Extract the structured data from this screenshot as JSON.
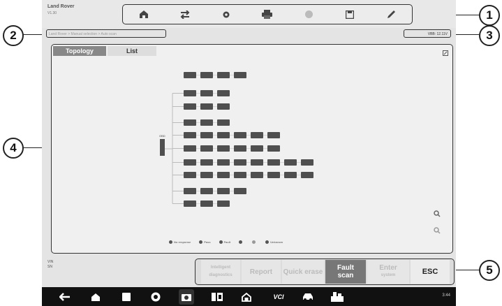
{
  "header": {
    "vehicle": "Land Rover",
    "sub": "V1.30"
  },
  "toolbar": {
    "items": [
      "home-icon",
      "swap-icon",
      "settings-icon",
      "print-icon",
      "help-icon",
      "save-icon",
      "edit-icon"
    ]
  },
  "breadcrumb": {
    "text": "Land Rover > Manual selection > Auto scan"
  },
  "voltage": {
    "text": "VBB: 12.11V"
  },
  "tabs": {
    "topology": "Topology",
    "list": "List"
  },
  "diagram": {
    "hub_label": "OBD",
    "rows": [
      {
        "labels": [
          "",
          "",
          "",
          ""
        ]
      },
      {
        "labels": [
          "",
          "",
          ""
        ]
      },
      {
        "labels": [
          "",
          "",
          ""
        ]
      },
      {
        "labels": [
          "",
          "",
          ""
        ]
      },
      {
        "labels": [
          "",
          "",
          "",
          "",
          "",
          ""
        ]
      },
      {
        "labels": [
          "",
          "",
          "",
          "",
          "",
          ""
        ]
      },
      {
        "labels": [
          "",
          "",
          "",
          "",
          "",
          "",
          "",
          ""
        ]
      },
      {
        "labels": [
          "",
          "",
          "",
          "",
          "",
          "",
          "",
          ""
        ]
      },
      {
        "labels": [
          "",
          "",
          "",
          ""
        ]
      },
      {
        "labels": [
          "",
          "",
          ""
        ]
      }
    ]
  },
  "legend": [
    "No response",
    "Pass",
    "Fault",
    "",
    "",
    "Unknown"
  ],
  "bottom_info": {
    "line1": "VIN",
    "line2": "SN"
  },
  "functions": {
    "intelligent": "Intelligent diagnostics",
    "report": "Report",
    "quick": "Quick erase",
    "fault1": "Fault",
    "fault2": "scan",
    "enter1": "Enter",
    "enter2": "system",
    "esc": "ESC"
  },
  "nav": {
    "vci": "VCI",
    "clock": "3:44"
  },
  "callouts": [
    "1",
    "2",
    "3",
    "4",
    "5"
  ],
  "colors": {
    "module": "#4f4f4f",
    "active_tab": "#888888",
    "active_button": "#777777"
  }
}
